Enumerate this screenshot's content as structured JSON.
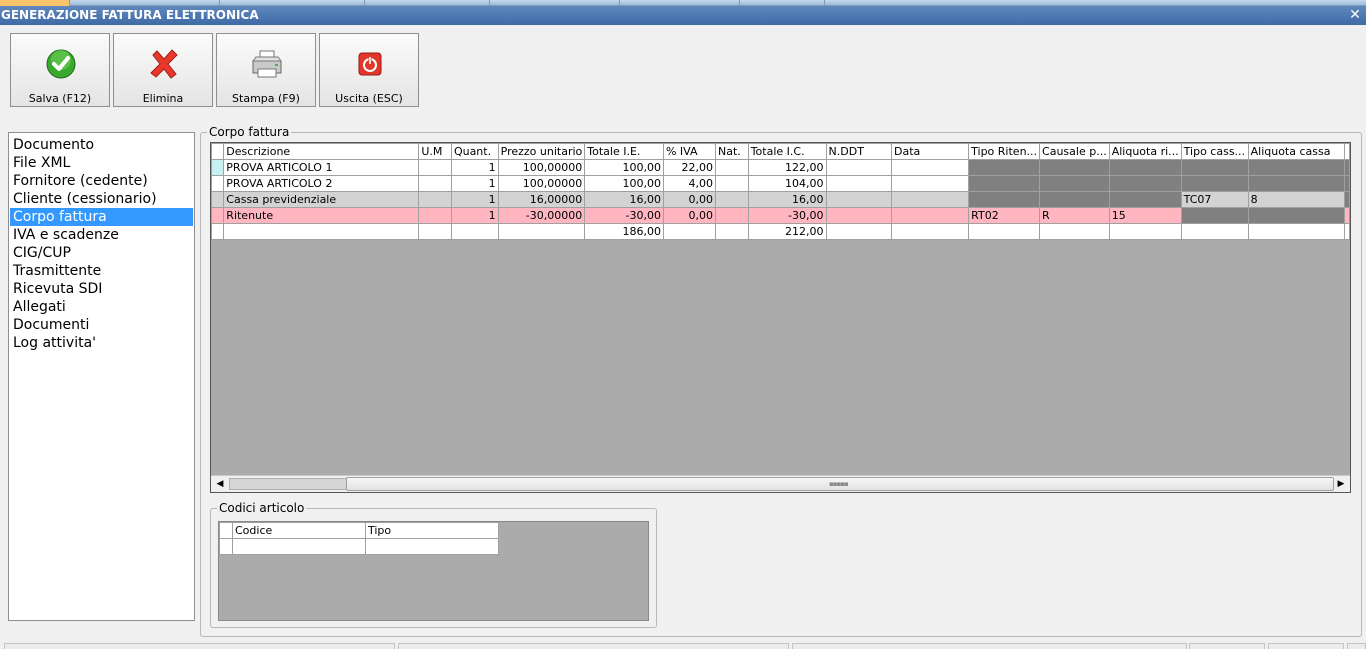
{
  "window": {
    "title": "GENERAZIONE FATTURA ELETTRONICA",
    "close_glyph": "✕"
  },
  "toolbar": {
    "save_label": "Salva (F12)",
    "delete_label": "Elimina",
    "print_label": "Stampa (F9)",
    "exit_label": "Uscita (ESC)",
    "icons": {
      "save": "check-icon",
      "delete": "red-x-icon",
      "print": "printer-icon",
      "exit": "power-icon"
    }
  },
  "nav": {
    "items": [
      "Documento",
      "File XML",
      "Fornitore (cedente)",
      "Cliente (cessionario)",
      "Corpo fattura",
      "IVA e scadenze",
      "CIG/CUP",
      "Trasmittente",
      "Ricevuta SDI",
      "Allegati",
      "Documenti",
      "Log attivita'"
    ],
    "selected": "Corpo fattura"
  },
  "body_group": {
    "title": "Corpo fattura",
    "columns": [
      "Descrizione",
      "U.M",
      "Quant.",
      "Prezzo unitario",
      "Totale I.E.",
      "% IVA",
      "Nat.",
      "Totale I.C.",
      "N.DDT",
      "Data",
      "Tipo Riten...",
      "Causale p...",
      "Aliquota ri...",
      "Tipo cass...",
      "Aliquota cassa"
    ],
    "rows": [
      {
        "desc": "PROVA ARTICOLO 1",
        "um": "",
        "qty": "1",
        "price": "100,00000",
        "tot_ie": "100,00",
        "iva": "22,00",
        "nat": "",
        "tot_ic": "122,00",
        "ddt": "",
        "data": "",
        "tipo_rit": "",
        "causale": "",
        "aliq_rit": "",
        "tipo_cassa": "",
        "aliq_cassa": ""
      },
      {
        "desc": "PROVA ARTICOLO 2",
        "um": "",
        "qty": "1",
        "price": "100,00000",
        "tot_ie": "100,00",
        "iva": "4,00",
        "nat": "",
        "tot_ic": "104,00",
        "ddt": "",
        "data": "",
        "tipo_rit": "",
        "causale": "",
        "aliq_rit": "",
        "tipo_cassa": "",
        "aliq_cassa": ""
      },
      {
        "desc": "Cassa previdenziale",
        "um": "",
        "qty": "1",
        "price": "16,00000",
        "tot_ie": "16,00",
        "iva": "0,00",
        "nat": "",
        "tot_ic": "16,00",
        "ddt": "",
        "data": "",
        "tipo_rit": "",
        "causale": "",
        "aliq_rit": "",
        "tipo_cassa": "TC07",
        "aliq_cassa": "8"
      },
      {
        "desc": "Ritenute",
        "um": "",
        "qty": "1",
        "price": "-30,00000",
        "tot_ie": "-30,00",
        "iva": "0,00",
        "nat": "",
        "tot_ic": "-30,00",
        "ddt": "",
        "data": "",
        "tipo_rit": "RT02",
        "causale": "R",
        "aliq_rit": "15",
        "tipo_cassa": "",
        "aliq_cassa": ""
      }
    ],
    "totals": {
      "tot_ie": "186,00",
      "tot_ic": "212,00"
    },
    "colors": {
      "cassa_row": "#d3d3d3",
      "ritenute_row": "#ffb6c1",
      "disabled_cell": "#808080",
      "grid_bg": "#ababab"
    }
  },
  "codes_group": {
    "title": "Codici articolo",
    "columns": [
      "Codice",
      "Tipo"
    ]
  },
  "colors": {
    "titlebar": "#3e6aa6",
    "selection": "#3399ff"
  }
}
